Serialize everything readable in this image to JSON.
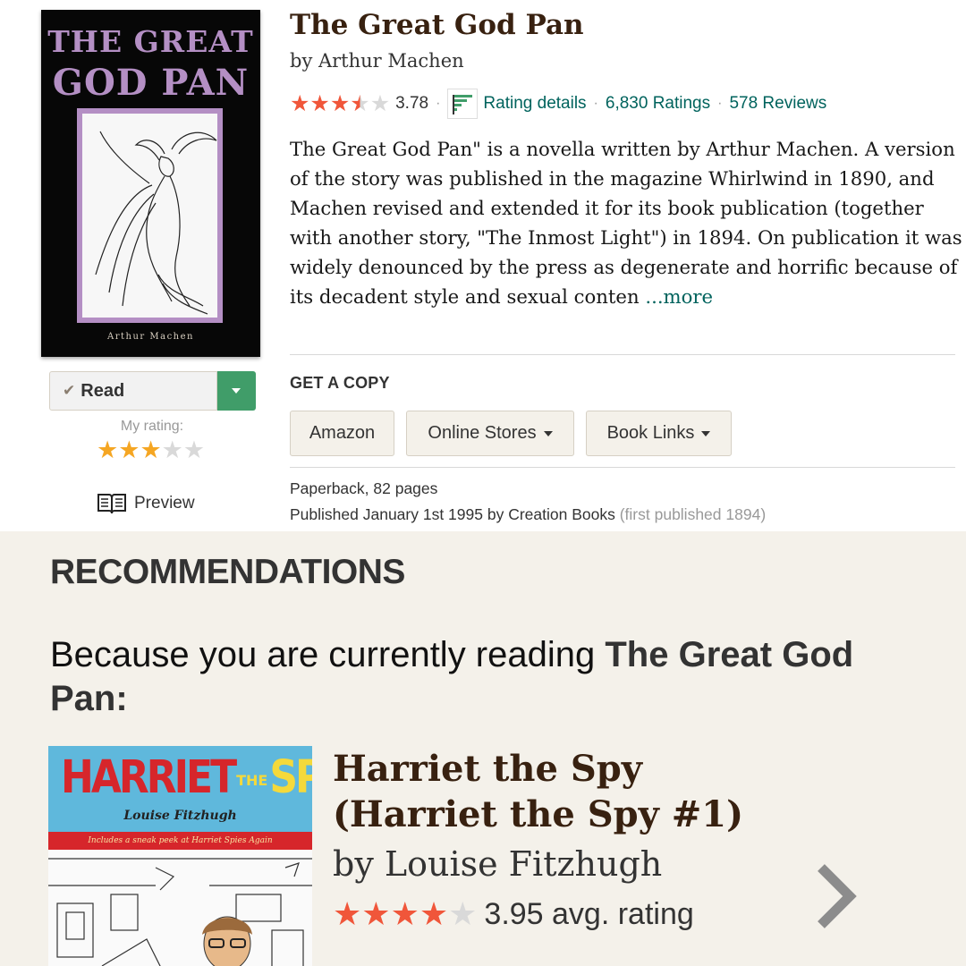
{
  "book": {
    "cover": {
      "title_line1": "THE GREAT",
      "title_line2": "GOD PAN",
      "author": "Arthur Machen"
    },
    "title": "The Great God Pan",
    "author": "by Arthur Machen",
    "rating": 3.78,
    "avg_rating": "3.78",
    "rating_separator": "·",
    "rating_details_label": "Rating details",
    "ratings_count": "6,830 Ratings",
    "reviews_count": "578 Reviews",
    "description": "The Great God Pan\" is a novella written by Arthur Machen. A version of the story was published in the magazine Whirlwind in 1890, and Machen revised and extended it for its book publication (together with another story, \"The Inmost Light\") in 1894. On publication it was widely denounced by the press as degenerate and horrific because of its decadent style and sexual conten",
    "more_label": "...more",
    "shelf_status": "Read",
    "my_rating_label": "My rating:",
    "my_rating": 3,
    "preview_label": "Preview",
    "get_copy_label": "GET A COPY",
    "stores": {
      "amazon": "Amazon",
      "online_stores": "Online Stores",
      "book_links": "Book Links"
    },
    "format": "Paperback, 82 pages",
    "published": "Published January 1st 1995 by Creation Books",
    "first_published": "(first published 1894)"
  },
  "recommendations": {
    "heading": "RECOMMENDATIONS",
    "because_prefix": "Because you are currently reading",
    "because_title": "The Great God Pan",
    "because_suffix": ":",
    "item": {
      "cover": {
        "title_a": "HARRIET",
        "title_b": "THE",
        "title_c": "SPY",
        "author": "Louise Fitzhugh",
        "band": "Includes a sneak peek at Harriet Spies Again"
      },
      "title": "Harriet the Spy (Harriet the Spy #1)",
      "author": "by Louise Fitzhugh",
      "rating": 3.95,
      "avg_rating": "3.95 avg. rating"
    }
  },
  "colors": {
    "brand_brown": "#382110",
    "link_teal": "#00635d",
    "star_red": "#f0563a",
    "star_yellow": "#f5a623",
    "read_green": "#409d69",
    "recs_bg": "#f4f1ea"
  },
  "icons": [
    "check-icon",
    "dropdown-arrow-icon",
    "open-book-icon",
    "rating-details-icon",
    "caret-down-icon",
    "chevron-right-icon"
  ]
}
